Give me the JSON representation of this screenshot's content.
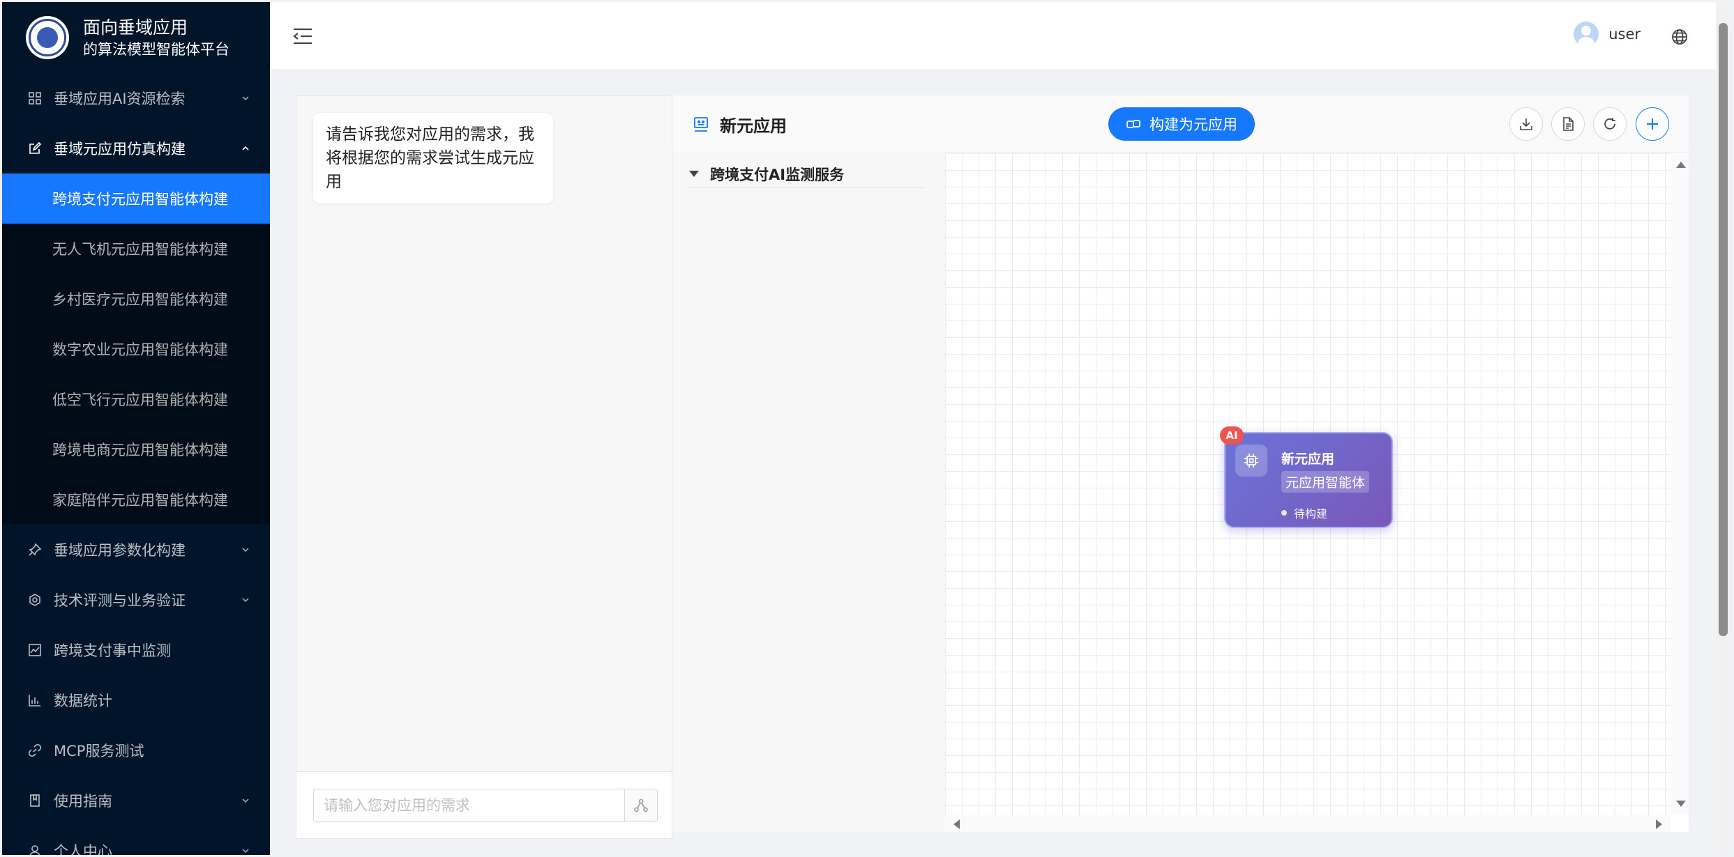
{
  "brand": {
    "line1": "面向垂域应用",
    "line2": "的算法模型智能体平台"
  },
  "sidebar": {
    "items": [
      {
        "label": "垂域应用AI资源检索",
        "icon": "grid-icon",
        "expandable": true
      },
      {
        "label": "垂域元应用仿真构建",
        "icon": "edit-icon",
        "expandable": true,
        "open": true
      },
      {
        "label": "垂域应用参数化构建",
        "icon": "pin-icon",
        "expandable": true
      },
      {
        "label": "技术评测与业务验证",
        "icon": "badge-icon",
        "expandable": true
      },
      {
        "label": "跨境支付事中监测",
        "icon": "line-chart-icon",
        "expandable": false
      },
      {
        "label": "数据统计",
        "icon": "bar-chart-icon",
        "expandable": false
      },
      {
        "label": "MCP服务测试",
        "icon": "link-icon",
        "expandable": false
      },
      {
        "label": "使用指南",
        "icon": "book-icon",
        "expandable": true
      },
      {
        "label": "个人中心",
        "icon": "user-icon",
        "expandable": true
      }
    ],
    "submenu": [
      {
        "label": "跨境支付元应用智能体构建",
        "active": true
      },
      {
        "label": "无人飞机元应用智能体构建"
      },
      {
        "label": "乡村医疗元应用智能体构建"
      },
      {
        "label": "数字农业元应用智能体构建"
      },
      {
        "label": "低空飞行元应用智能体构建"
      },
      {
        "label": "跨境电商元应用智能体构建"
      },
      {
        "label": "家庭陪伴元应用智能体构建"
      }
    ]
  },
  "header": {
    "username": "user"
  },
  "chat": {
    "bot_message": "请告诉我您对应用的需求，我将根据您的需求尝试生成元应用",
    "input_placeholder": "请输入您对应用的需求"
  },
  "canvas": {
    "title": "新元应用",
    "build_button": "构建为元应用",
    "tree_node": "跨境支付AI监测服务",
    "node": {
      "badge": "AI",
      "title": "新元应用",
      "tag": "元应用智能体",
      "status": "待构建"
    }
  },
  "colors": {
    "sidebar_bg": "#001529",
    "submenu_bg": "#000c17",
    "accent": "#1677ff",
    "node_gradient_start": "#6a73d9",
    "node_gradient_end": "#7a58b8",
    "ai_badge": "#f0534d"
  }
}
